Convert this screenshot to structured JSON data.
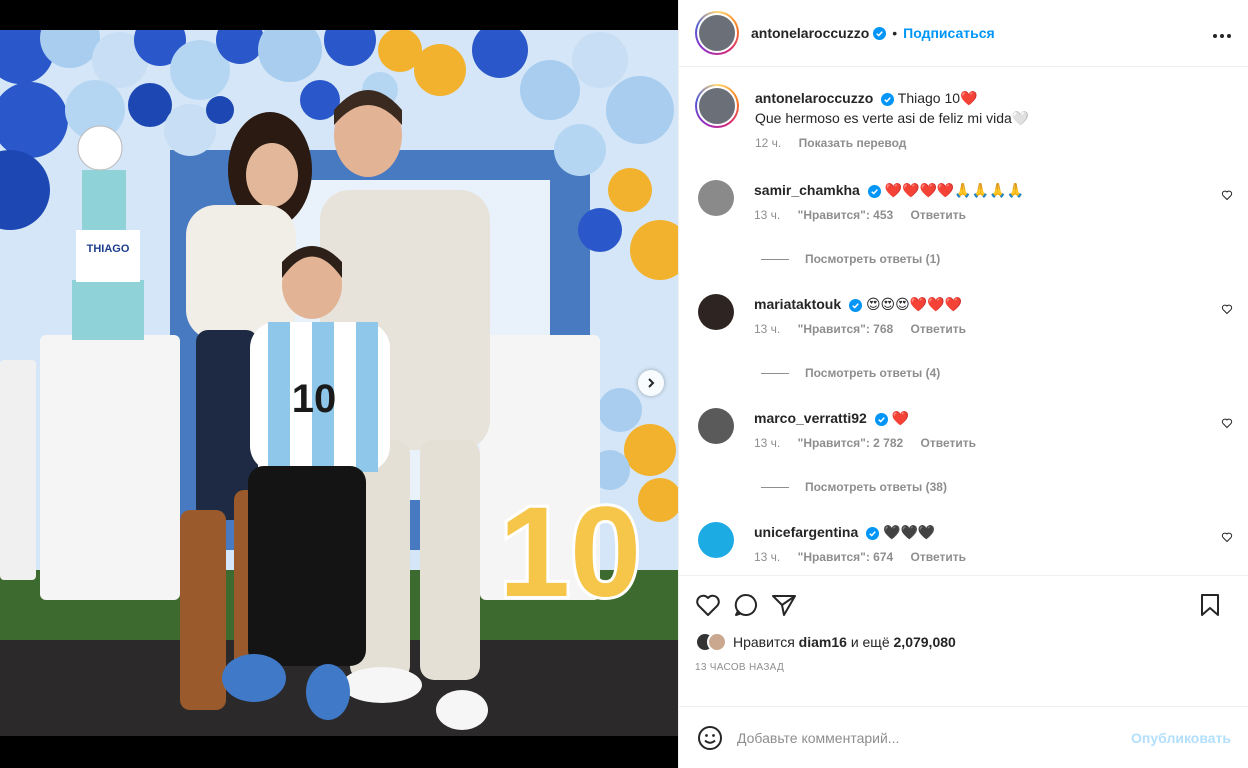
{
  "post": {
    "author": "antonelaroccuzzo",
    "follow_label": "Подписаться",
    "more_icon": "more-horizontal-icon",
    "verified_color": "#0095f6"
  },
  "caption": {
    "username": "antonelaroccuzzo",
    "line1": "Thiago 10❤️",
    "line2": "Que hermoso es verte asi de feliz mi vida🤍",
    "time": "12 ч.",
    "translate": "Показать перевод"
  },
  "comments": [
    {
      "username": "samir_chamkha",
      "text": "❤️❤️❤️❤️🙏🙏🙏🙏",
      "time": "13 ч.",
      "likes": "\"Нравится\": 453",
      "reply": "Ответить",
      "replies": "Посмотреть ответы (1)"
    },
    {
      "username": "mariataktouk",
      "text": "😍😍😍❤️❤️❤️",
      "time": "13 ч.",
      "likes": "\"Нравится\": 768",
      "reply": "Ответить",
      "replies": "Посмотреть ответы (4)"
    },
    {
      "username": "marco_verratti92",
      "text": "❤️",
      "time": "13 ч.",
      "likes": "\"Нравится\": 2 782",
      "reply": "Ответить",
      "replies": "Посмотреть ответы (38)"
    },
    {
      "username": "unicefargentina",
      "text": "🖤🖤🖤",
      "time": "13 ч.",
      "likes": "\"Нравится\": 674",
      "reply": "Ответить",
      "replies": ""
    }
  ],
  "likes": {
    "prefix": "Нравится",
    "user": "diam16",
    "middle": "и ещё",
    "count": "2,079,080"
  },
  "posted_ago": "13 часов назад",
  "add_comment": {
    "placeholder": "Добавьте комментарий...",
    "publish": "Опубликовать"
  },
  "photo": {
    "cake_label": "THIAGO",
    "number_label": "10",
    "jersey_number": "10"
  }
}
